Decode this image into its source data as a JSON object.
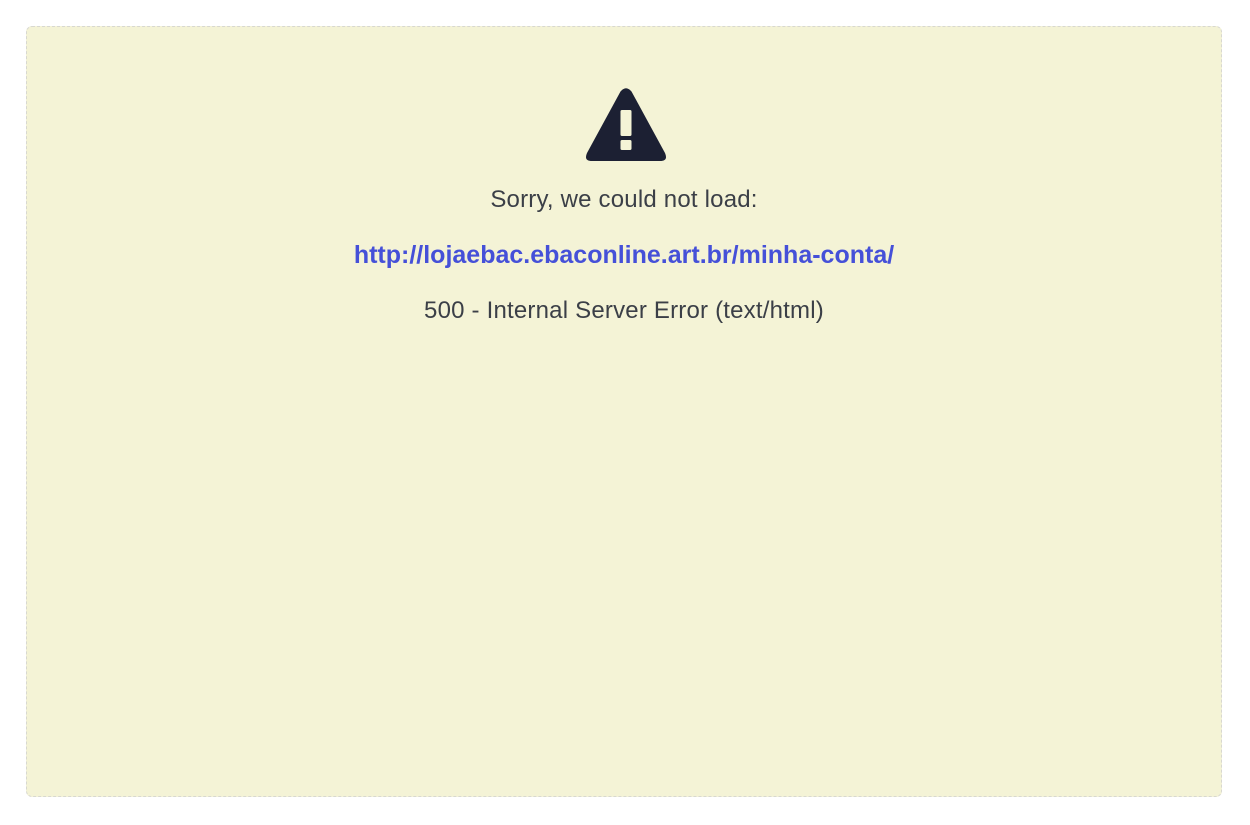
{
  "error": {
    "icon": "warning-triangle-icon",
    "icon_color": "#1c2033",
    "background_color": "#f4f3d6",
    "message": "Sorry, we could not load:",
    "url": "http://lojaebac.ebaconline.art.br/minha-conta/",
    "url_color": "#4550d8",
    "status": "500 - Internal Server Error (text/html)"
  }
}
